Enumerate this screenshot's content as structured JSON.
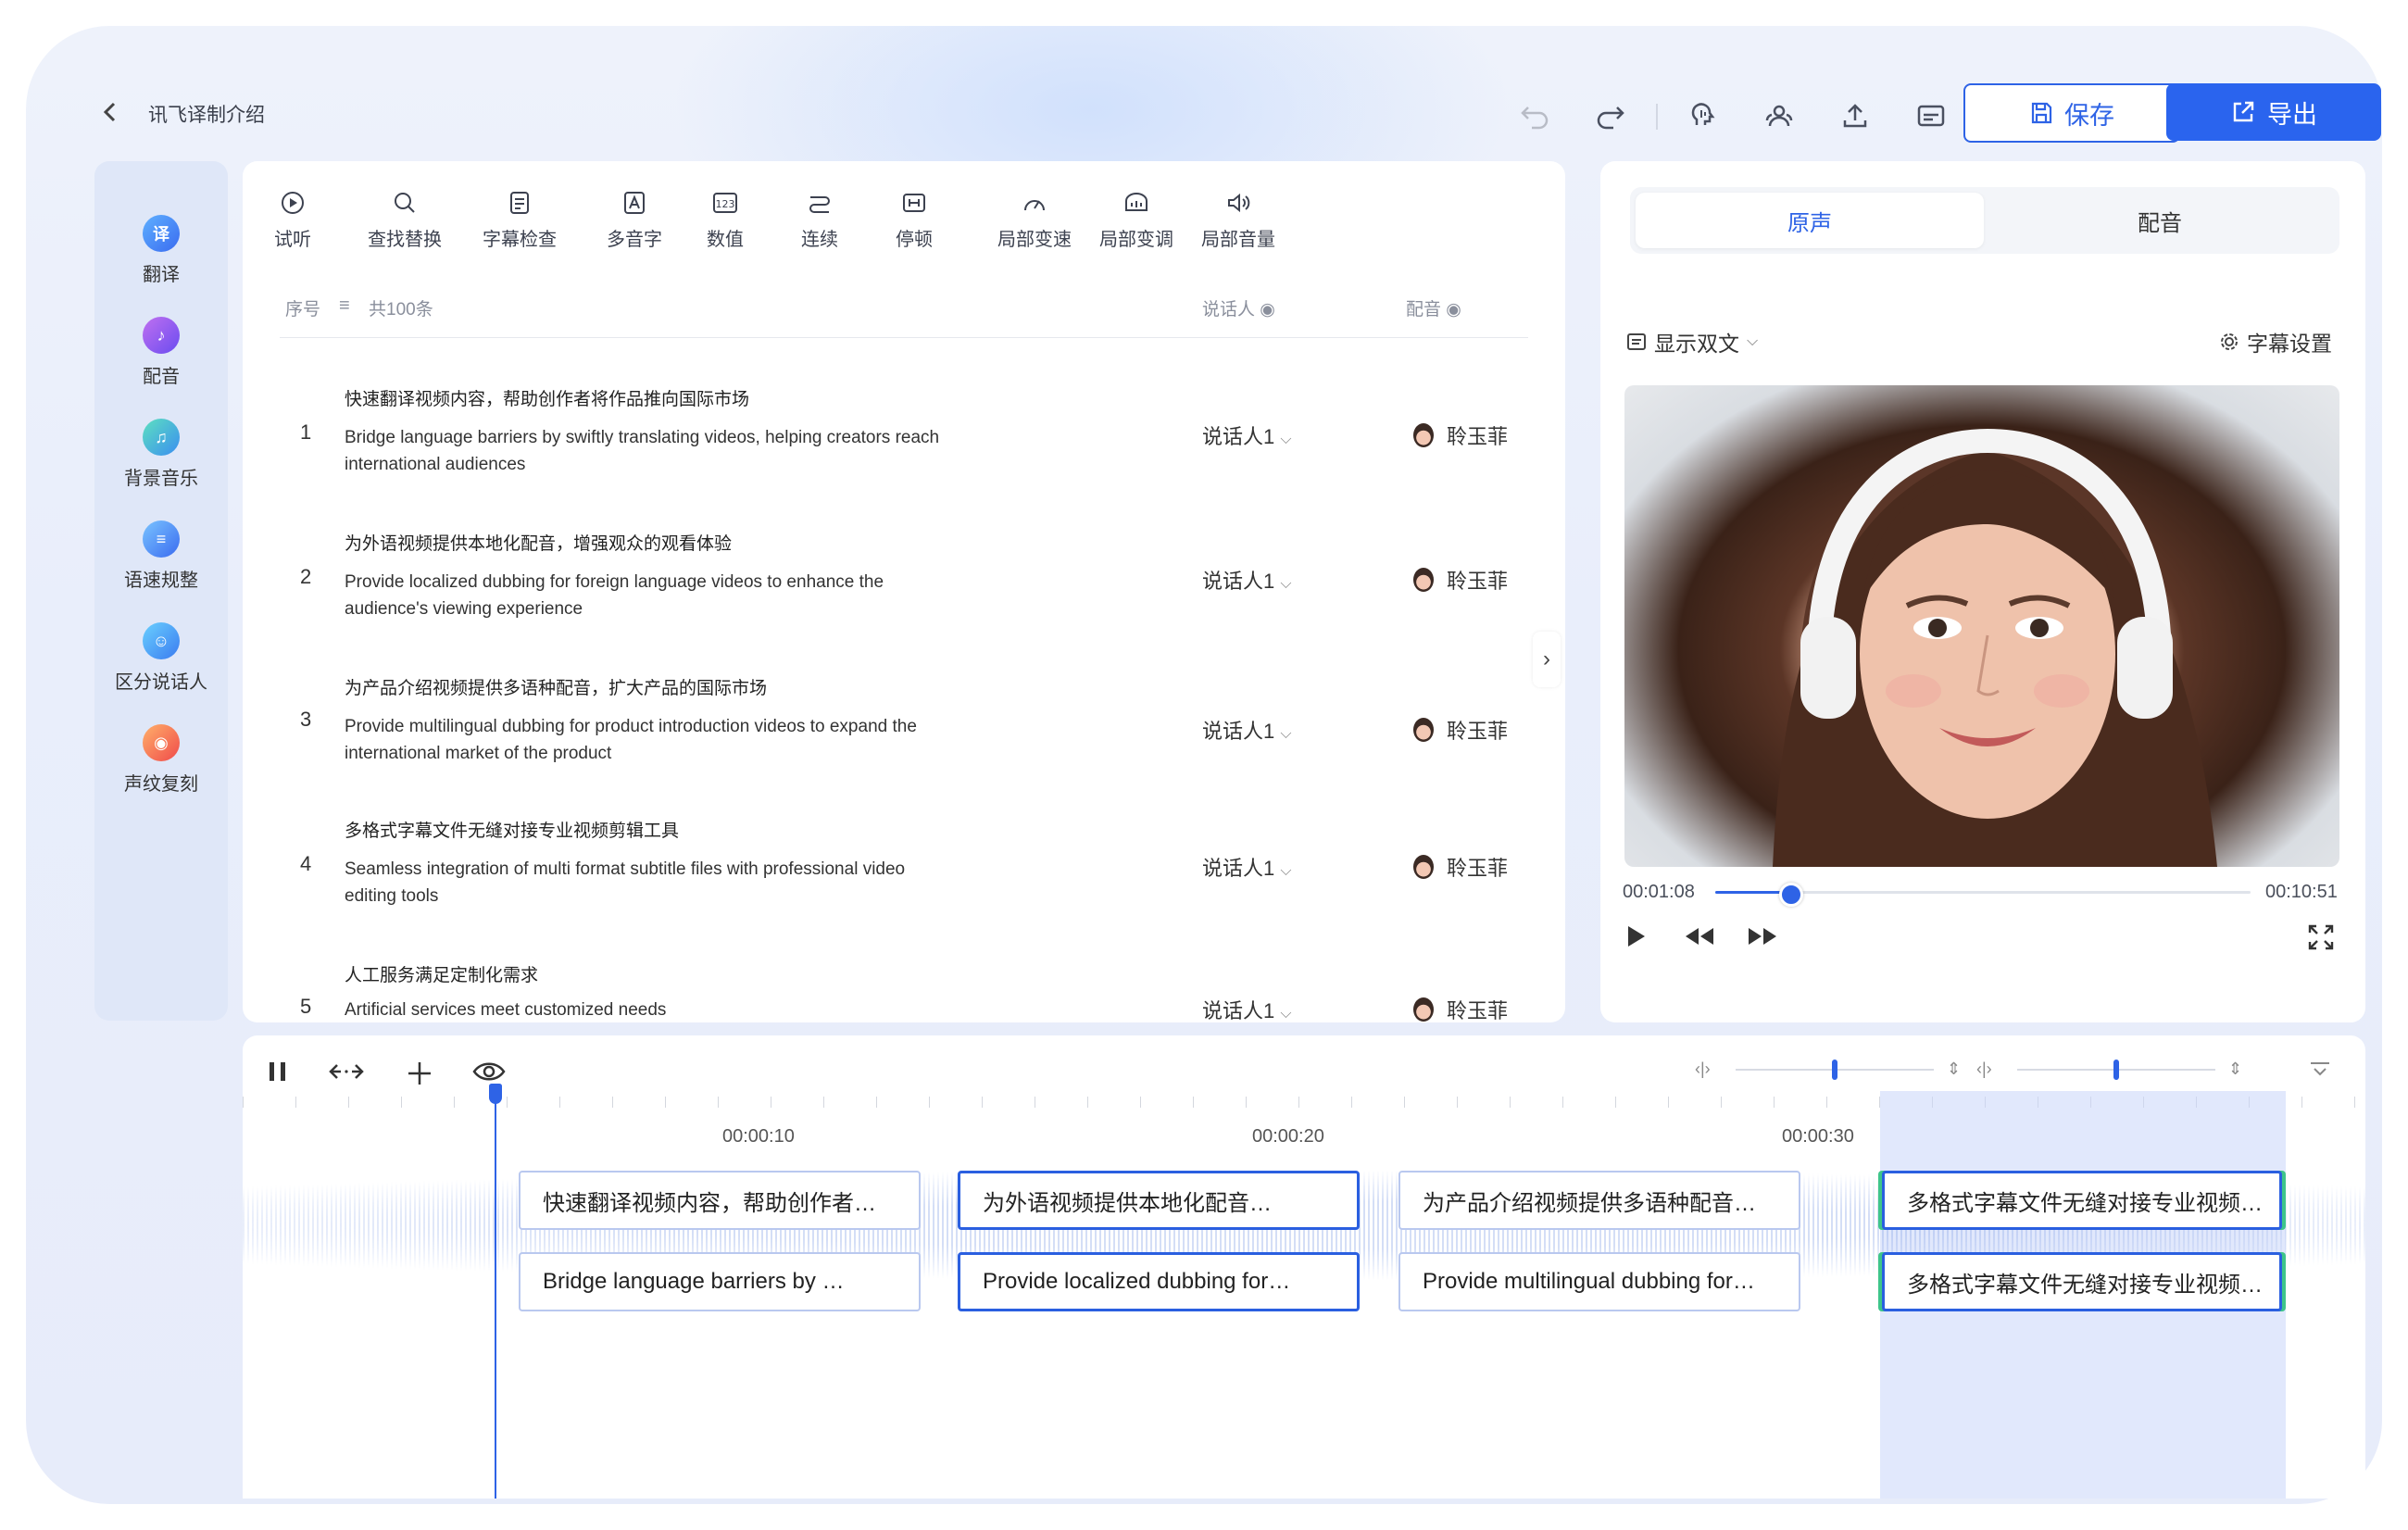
{
  "header": {
    "back_icon": "chevron-left-icon",
    "title": "讯飞译制介绍",
    "save_label": "保存",
    "export_label": "导出"
  },
  "sidebar": {
    "items": [
      {
        "label": "翻译",
        "icon": "translate-icon",
        "color": "#3a7bf0"
      },
      {
        "label": "配音",
        "icon": "dubbing-icon",
        "color": "#8a5cf0"
      },
      {
        "label": "背景音乐",
        "icon": "music-icon",
        "color": "#33b6c8"
      },
      {
        "label": "语速规整",
        "icon": "speed-icon",
        "color": "#4a8ef5"
      },
      {
        "label": "区分说话人",
        "icon": "speakers-icon",
        "color": "#4aa0f0"
      },
      {
        "label": "声纹复刻",
        "icon": "voiceprint-icon",
        "color": "#f06a4a"
      }
    ]
  },
  "toolbar": {
    "items": [
      "试听",
      "查找替换",
      "字幕检查",
      "多音字",
      "数值",
      "连续",
      "停顿",
      "局部变速",
      "局部变调",
      "局部音量"
    ]
  },
  "list": {
    "col_index": "序号",
    "count": "共100条",
    "col_speaker": "说话人",
    "col_dub": "配音",
    "rows": [
      {
        "n": "1",
        "zh": "快速翻译视频内容，帮助创作者将作品推向国际市场",
        "en": "Bridge language barriers by swiftly translating videos, helping creators reach international audiences",
        "speaker": "说话人1",
        "voice": "聆玉菲"
      },
      {
        "n": "2",
        "zh": "为外语视频提供本地化配音，增强观众的观看体验",
        "en": "Provide localized dubbing for foreign language videos to enhance the audience's viewing experience",
        "speaker": "说话人1",
        "voice": "聆玉菲"
      },
      {
        "n": "3",
        "zh": "为产品介绍视频提供多语种配音，扩大产品的国际市场",
        "en": "Provide multilingual dubbing for product introduction videos to expand the international market of the product",
        "speaker": "说话人1",
        "voice": "聆玉菲"
      },
      {
        "n": "4",
        "zh": "多格式字幕文件无缝对接专业视频剪辑工具",
        "en": "Seamless integration of multi format subtitle files with professional video editing tools",
        "speaker": "说话人1",
        "voice": "聆玉菲"
      },
      {
        "n": "5",
        "zh": "人工服务满足定制化需求",
        "en": "Artificial services meet customized needs",
        "speaker": "说话人1",
        "voice": "聆玉菲"
      }
    ]
  },
  "preview": {
    "tab_original": "原声",
    "tab_dub": "配音",
    "bilingual": "显示双文",
    "subtitle_settings": "字幕设置",
    "current_time": "00:01:08",
    "total_time": "00:10:51",
    "progress": 0.136
  },
  "timeline": {
    "ticks": [
      "00:00:10",
      "00:00:20",
      "00:00:30"
    ],
    "clips_zh": [
      "快速翻译视频内容，帮助创作者…",
      "为外语视频提供本地化配音…",
      "为产品介绍视频提供多语种配音…",
      "多格式字幕文件无缝对接专业视频…"
    ],
    "clips_en": [
      "Bridge language barriers by …",
      "Provide localized dubbing for…",
      "Provide multilingual dubbing for…",
      "多格式字幕文件无缝对接专业视频…"
    ]
  }
}
